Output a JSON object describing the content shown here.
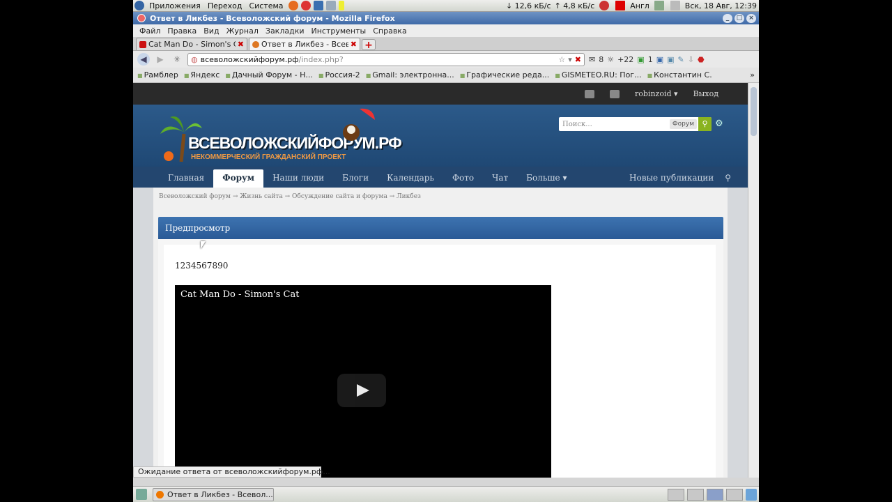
{
  "gnome_panel": {
    "menus": [
      "Приложения",
      "Переход",
      "Система"
    ],
    "net_down": "↓ 12,6 кБ/с",
    "net_up": "↑ 4,8 кБ/с",
    "layout": "Англ",
    "clock": "Вск, 18 Авг, 12:39"
  },
  "window": {
    "title": "Ответ в Ликбез - Всеволожский форум - Mozilla Firefox"
  },
  "firefox_menu": [
    "Файл",
    "Правка",
    "Вид",
    "Журнал",
    "Закладки",
    "Инструменты",
    "Справка"
  ],
  "tabs": [
    {
      "title": "Cat Man Do - Simon's Ca...",
      "favicon_color": "#cc1111",
      "active": false
    },
    {
      "title": "Ответ в Ликбез - Всево...",
      "favicon_color": "#dd7722",
      "active": true
    }
  ],
  "url": {
    "host": "всеволожскийфорум.рф",
    "path": "/index.php?"
  },
  "navbar_addons": {
    "mail_count": "8",
    "weather": "+22",
    "counter": "1"
  },
  "bookmarks": [
    "Рамблер",
    "Яндекс",
    "Дачный Форум - Н...",
    "Россия-2",
    "Gmail: электронна...",
    "Графические реда...",
    "GISMETEO.RU: Пог...",
    "Константин С."
  ],
  "forum": {
    "user": "robinzoid",
    "logout": "Выход",
    "brand": "ВСЕВОЛОЖСКИЙФОРУМ.РФ",
    "tagline": "НЕКОММЕРЧЕСКИЙ ГРАЖДАНСКИЙ ПРОЕКТ",
    "search_placeholder": "Поиск...",
    "search_scope": "Форум",
    "nav": [
      "Главная",
      "Форум",
      "Наши люди",
      "Блоги",
      "Календарь",
      "Фото",
      "Чат",
      "Больше"
    ],
    "nav_active_index": 1,
    "nav_right": "Новые публикации",
    "breadcrumb": [
      "Всеволожский форум",
      "Жизнь сайта",
      "Обсуждение сайта и форума",
      "Ликбез"
    ],
    "preview_title": "Предпросмотр",
    "post_text": "1234567890",
    "video_title": "Cat Man Do - Simon's Cat"
  },
  "status_text": "Ожидание ответа от всеволожскийфорум.рф...",
  "taskbar": {
    "task_title": "Ответ в Ликбез - Всевол..."
  },
  "colors": {
    "header_blue": "#2c5a8a",
    "nav_blue": "#23466f",
    "preview_blue": "#3d73b0",
    "search_green": "#8ab31f"
  }
}
